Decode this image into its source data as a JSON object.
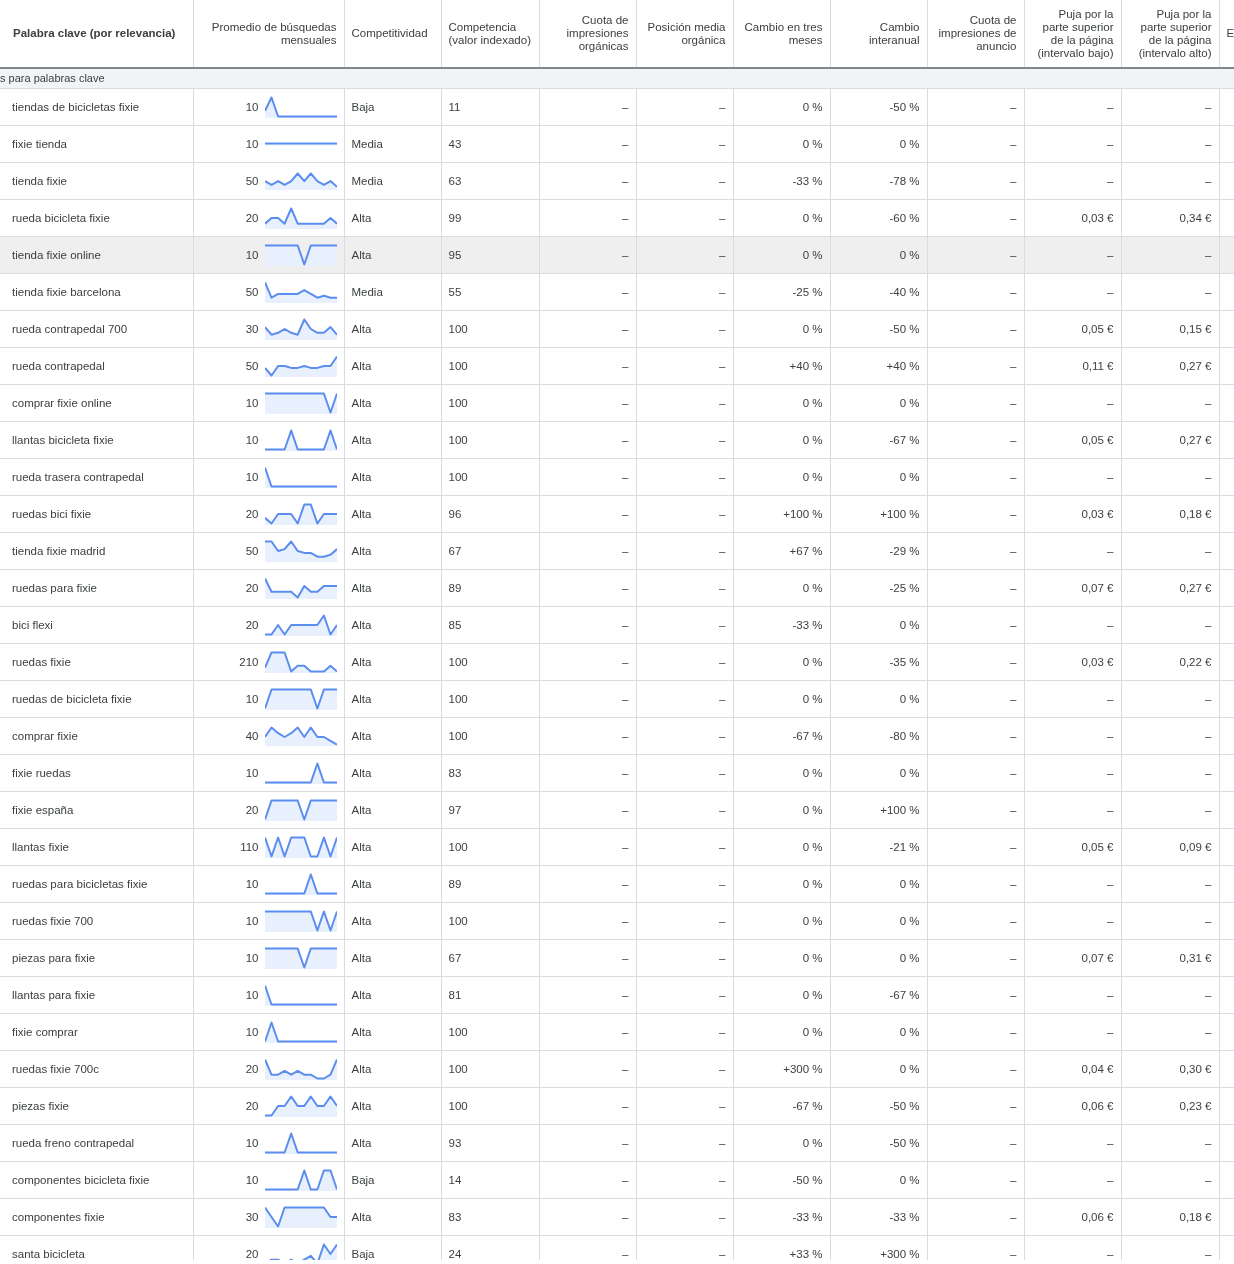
{
  "table": {
    "columns": [
      {
        "label": "Palabra clave (por relevancia)"
      },
      {
        "label": "Promedio de búsquedas mensuales"
      },
      {
        "label": "Competitividad"
      },
      {
        "label": "Competencia (valor indexado)"
      },
      {
        "label": "Cuota de impresiones orgánicas"
      },
      {
        "label": "Posición media orgánica"
      },
      {
        "label": "Cambio en tres meses"
      },
      {
        "label": "Cambio interanual"
      },
      {
        "label": "Cuota de impresiones de anuncio"
      },
      {
        "label": "Puja por la parte superior de la página (intervalo bajo)"
      },
      {
        "label": "Puja por la parte superior de la página (intervalo alto)"
      },
      {
        "label": "E"
      }
    ],
    "group_label": "s para palabras clave",
    "rows": [
      {
        "cells": [
          "tiendas de bicicletas fixie",
          "10",
          "Baja",
          "11",
          "–",
          "–",
          "0 %",
          "-50 %",
          "–",
          "–",
          "–"
        ],
        "hovered": false
      },
      {
        "cells": [
          "fixie tienda",
          "10",
          "Media",
          "43",
          "–",
          "–",
          "0 %",
          "0 %",
          "–",
          "–",
          "–"
        ],
        "hovered": false
      },
      {
        "cells": [
          "tienda fixie",
          "50",
          "Media",
          "63",
          "–",
          "–",
          "-33 %",
          "-78 %",
          "–",
          "–",
          "–"
        ],
        "hovered": false
      },
      {
        "cells": [
          "rueda bicicleta fixie",
          "20",
          "Alta",
          "99",
          "–",
          "–",
          "0 %",
          "-60 %",
          "–",
          "0,03 €",
          "0,34 €"
        ],
        "hovered": false
      },
      {
        "cells": [
          "tienda fixie online",
          "10",
          "Alta",
          "95",
          "–",
          "–",
          "0 %",
          "0 %",
          "–",
          "–",
          "–"
        ],
        "hovered": true
      },
      {
        "cells": [
          "tienda fixie barcelona",
          "50",
          "Media",
          "55",
          "–",
          "–",
          "-25 %",
          "-40 %",
          "–",
          "–",
          "–"
        ],
        "hovered": false
      },
      {
        "cells": [
          "rueda contrapedal 700",
          "30",
          "Alta",
          "100",
          "–",
          "–",
          "0 %",
          "-50 %",
          "–",
          "0,05 €",
          "0,15 €"
        ],
        "hovered": false
      },
      {
        "cells": [
          "rueda contrapedal",
          "50",
          "Alta",
          "100",
          "–",
          "–",
          "+40 %",
          "+40 %",
          "–",
          "0,11 €",
          "0,27 €"
        ],
        "hovered": false
      },
      {
        "cells": [
          "comprar fixie online",
          "10",
          "Alta",
          "100",
          "–",
          "–",
          "0 %",
          "0 %",
          "–",
          "–",
          "–"
        ],
        "hovered": false
      },
      {
        "cells": [
          "llantas bicicleta fixie",
          "10",
          "Alta",
          "100",
          "–",
          "–",
          "0 %",
          "-67 %",
          "–",
          "0,05 €",
          "0,27 €"
        ],
        "hovered": false
      },
      {
        "cells": [
          "rueda trasera contrapedal",
          "10",
          "Alta",
          "100",
          "–",
          "–",
          "0 %",
          "0 %",
          "–",
          "–",
          "–"
        ],
        "hovered": false
      },
      {
        "cells": [
          "ruedas bici fixie",
          "20",
          "Alta",
          "96",
          "–",
          "–",
          "+100 %",
          "+100 %",
          "–",
          "0,03 €",
          "0,18 €"
        ],
        "hovered": false
      },
      {
        "cells": [
          "tienda fixie madrid",
          "50",
          "Alta",
          "67",
          "–",
          "–",
          "+67 %",
          "-29 %",
          "–",
          "–",
          "–"
        ],
        "hovered": false
      },
      {
        "cells": [
          "ruedas para fixie",
          "20",
          "Alta",
          "89",
          "–",
          "–",
          "0 %",
          "-25 %",
          "–",
          "0,07 €",
          "0,27 €"
        ],
        "hovered": false
      },
      {
        "cells": [
          "bici flexi",
          "20",
          "Alta",
          "85",
          "–",
          "–",
          "-33 %",
          "0 %",
          "–",
          "–",
          "–"
        ],
        "hovered": false
      },
      {
        "cells": [
          "ruedas fixie",
          "210",
          "Alta",
          "100",
          "–",
          "–",
          "0 %",
          "-35 %",
          "–",
          "0,03 €",
          "0,22 €"
        ],
        "hovered": false
      },
      {
        "cells": [
          "ruedas de bicicleta fixie",
          "10",
          "Alta",
          "100",
          "–",
          "–",
          "0 %",
          "0 %",
          "–",
          "–",
          "–"
        ],
        "hovered": false
      },
      {
        "cells": [
          "comprar fixie",
          "40",
          "Alta",
          "100",
          "–",
          "–",
          "-67 %",
          "-80 %",
          "–",
          "–",
          "–"
        ],
        "hovered": false
      },
      {
        "cells": [
          "fixie ruedas",
          "10",
          "Alta",
          "83",
          "–",
          "–",
          "0 %",
          "0 %",
          "–",
          "–",
          "–"
        ],
        "hovered": false
      },
      {
        "cells": [
          "fixie españa",
          "20",
          "Alta",
          "97",
          "–",
          "–",
          "0 %",
          "+100 %",
          "–",
          "–",
          "–"
        ],
        "hovered": false
      },
      {
        "cells": [
          "llantas fixie",
          "110",
          "Alta",
          "100",
          "–",
          "–",
          "0 %",
          "-21 %",
          "–",
          "0,05 €",
          "0,09 €"
        ],
        "hovered": false
      },
      {
        "cells": [
          "ruedas para bicicletas fixie",
          "10",
          "Alta",
          "89",
          "–",
          "–",
          "0 %",
          "0 %",
          "–",
          "–",
          "–"
        ],
        "hovered": false
      },
      {
        "cells": [
          "ruedas fixie 700",
          "10",
          "Alta",
          "100",
          "–",
          "–",
          "0 %",
          "0 %",
          "–",
          "–",
          "–"
        ],
        "hovered": false
      },
      {
        "cells": [
          "piezas para fixie",
          "10",
          "Alta",
          "67",
          "–",
          "–",
          "0 %",
          "0 %",
          "–",
          "0,07 €",
          "0,31 €"
        ],
        "hovered": false
      },
      {
        "cells": [
          "llantas para fixie",
          "10",
          "Alta",
          "81",
          "–",
          "–",
          "0 %",
          "-67 %",
          "–",
          "–",
          "–"
        ],
        "hovered": false
      },
      {
        "cells": [
          "fixie comprar",
          "10",
          "Alta",
          "100",
          "–",
          "–",
          "0 %",
          "0 %",
          "–",
          "–",
          "–"
        ],
        "hovered": false
      },
      {
        "cells": [
          "ruedas fixie 700c",
          "20",
          "Alta",
          "100",
          "–",
          "–",
          "+300 %",
          "0 %",
          "–",
          "0,04 €",
          "0,30 €"
        ],
        "hovered": false
      },
      {
        "cells": [
          "piezas fixie",
          "20",
          "Alta",
          "100",
          "–",
          "–",
          "-67 %",
          "-50 %",
          "–",
          "0,06 €",
          "0,23 €"
        ],
        "hovered": false
      },
      {
        "cells": [
          "rueda freno contrapedal",
          "10",
          "Alta",
          "93",
          "–",
          "–",
          "0 %",
          "-50 %",
          "–",
          "–",
          "–"
        ],
        "hovered": false
      },
      {
        "cells": [
          "componentes bicicleta fixie",
          "10",
          "Baja",
          "14",
          "–",
          "–",
          "-50 %",
          "0 %",
          "–",
          "–",
          "–"
        ],
        "hovered": false
      },
      {
        "cells": [
          "componentes fixie",
          "30",
          "Alta",
          "83",
          "–",
          "–",
          "-33 %",
          "-33 %",
          "–",
          "0,06 €",
          "0,18 €"
        ],
        "hovered": false
      },
      {
        "cells": [
          "santa bicicleta",
          "20",
          "Baja",
          "24",
          "–",
          "–",
          "+33 %",
          "+300 %",
          "–",
          "–",
          "–"
        ],
        "hovered": false
      }
    ]
  }
}
